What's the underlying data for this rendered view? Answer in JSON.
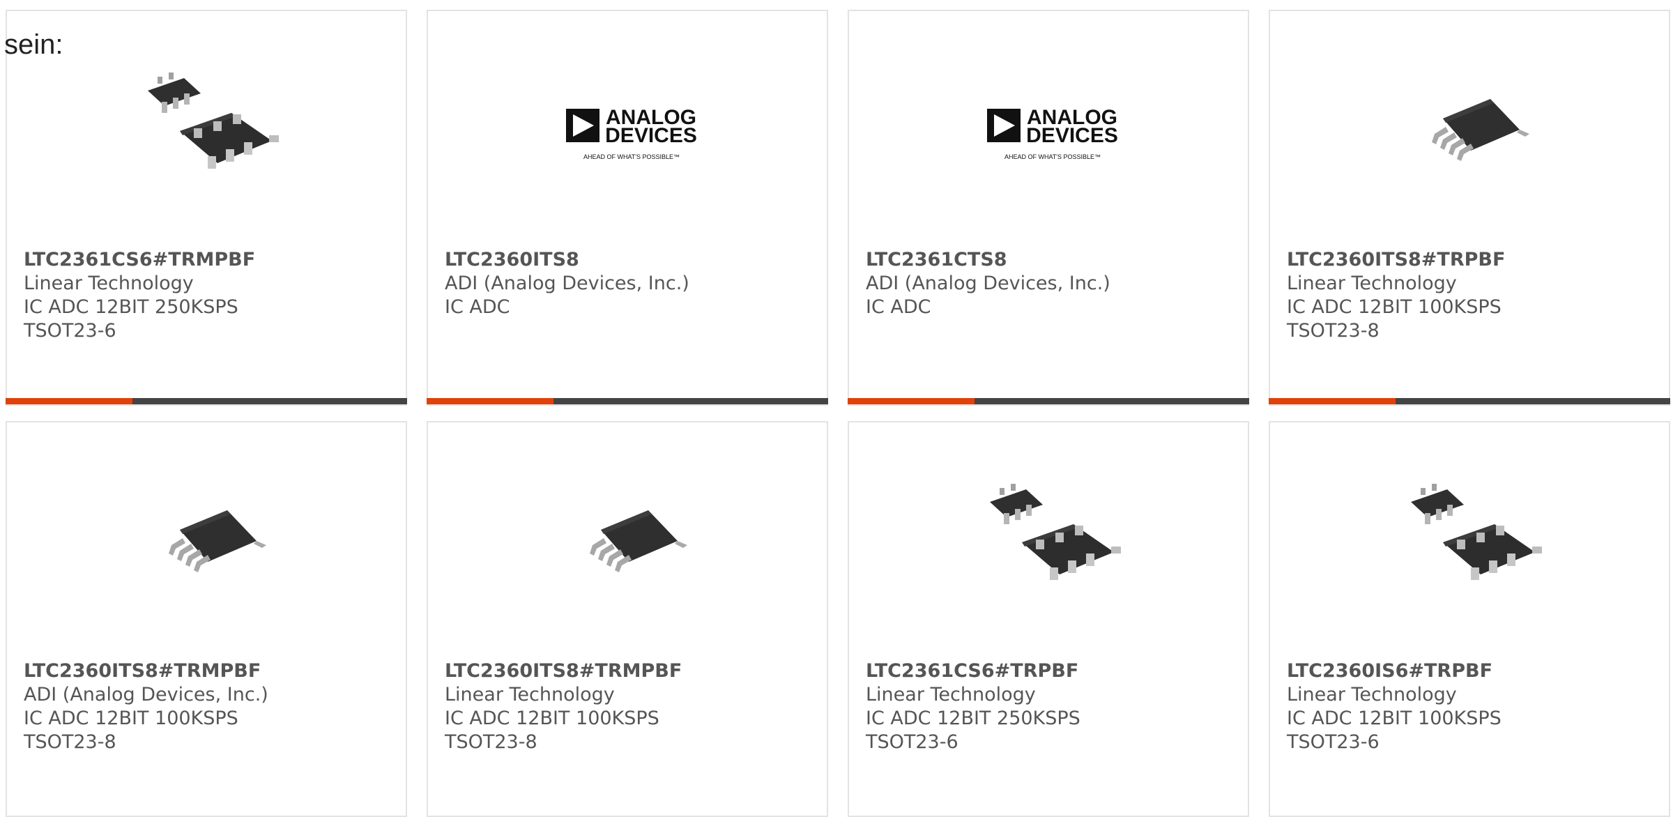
{
  "intro_text": "sein:",
  "colors": {
    "accent": "#e0420a",
    "bar": "#444444",
    "border": "#e3e3e3",
    "text": "#555555"
  },
  "logo": {
    "line1": "ANALOG",
    "line2": "DEVICES",
    "tagline": "AHEAD OF WHAT'S POSSIBLE™"
  },
  "products": [
    {
      "part_number": "LTC2361CS6#TRMPBF",
      "manufacturer": "Linear Technology",
      "description": "IC ADC 12BIT 250KSPS TSOT23-6",
      "image": "sot23-6-chip-icon",
      "show_bar": true
    },
    {
      "part_number": "LTC2360ITS8",
      "manufacturer": "ADI (Analog Devices, Inc.)",
      "description": "IC ADC",
      "image": "analog-devices-logo",
      "show_bar": true
    },
    {
      "part_number": "LTC2361CTS8",
      "manufacturer": "ADI (Analog Devices, Inc.)",
      "description": "IC ADC",
      "image": "analog-devices-logo",
      "show_bar": true
    },
    {
      "part_number": "LTC2360ITS8#TRPBF",
      "manufacturer": "Linear Technology",
      "description": "IC ADC 12BIT 100KSPS TSOT23-8",
      "image": "sot23-8-chip-icon",
      "show_bar": true
    },
    {
      "part_number": "LTC2360ITS8#TRMPBF",
      "manufacturer": "ADI (Analog Devices, Inc.)",
      "description": "IC ADC 12BIT 100KSPS TSOT23-8",
      "image": "sot23-8-chip-icon",
      "show_bar": false
    },
    {
      "part_number": "LTC2360ITS8#TRMPBF",
      "manufacturer": "Linear Technology",
      "description": "IC ADC 12BIT 100KSPS TSOT23-8",
      "image": "sot23-8-chip-icon",
      "show_bar": false
    },
    {
      "part_number": "LTC2361CS6#TRPBF",
      "manufacturer": "Linear Technology",
      "description": "IC ADC 12BIT 250KSPS TSOT23-6",
      "image": "sot23-6-chip-icon",
      "show_bar": false
    },
    {
      "part_number": "LTC2360IS6#TRPBF",
      "manufacturer": "Linear Technology",
      "description": "IC ADC 12BIT 100KSPS TSOT23-6",
      "image": "sot23-6-chip-icon",
      "show_bar": false
    }
  ]
}
